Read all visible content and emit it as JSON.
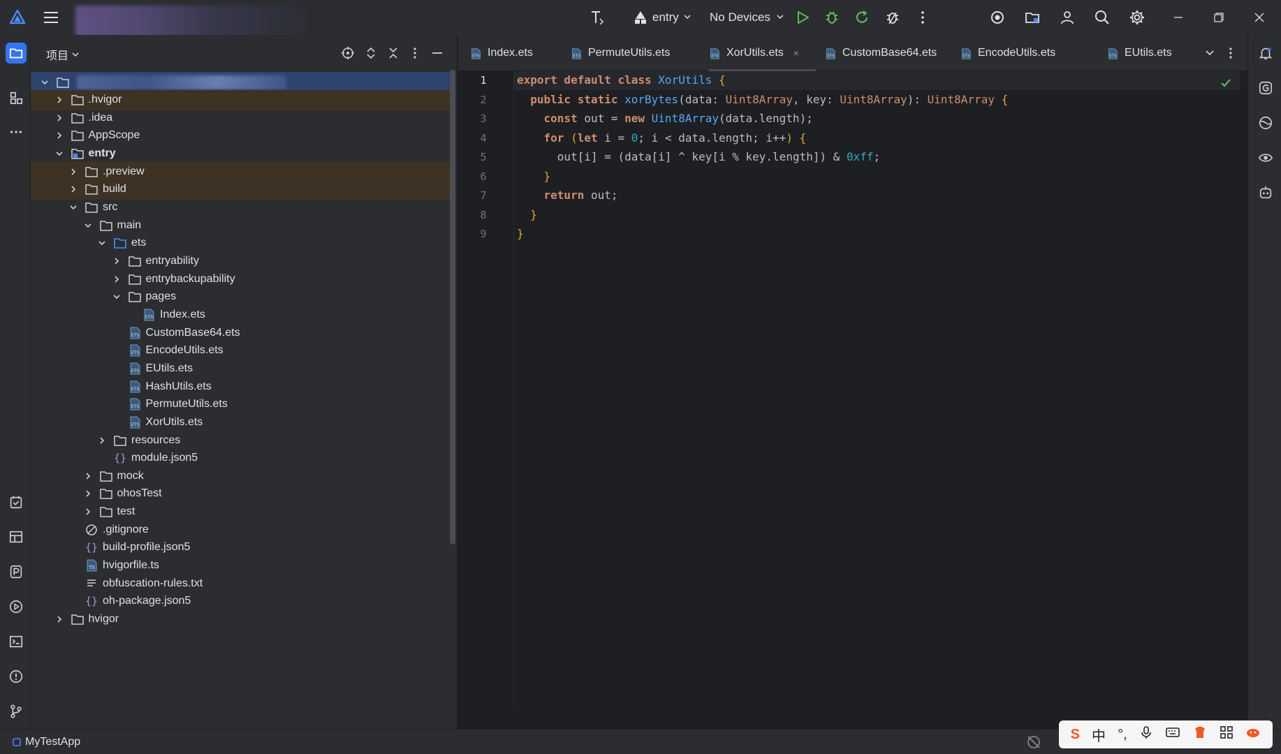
{
  "toolbar": {
    "run_config": "entry",
    "device": "No Devices"
  },
  "project_panel": {
    "title": "项目"
  },
  "tree": [
    {
      "label": "",
      "depth": 0,
      "type": "root",
      "expanded": true,
      "selected": true
    },
    {
      "label": ".hvigor",
      "depth": 1,
      "type": "folder",
      "expanded": false,
      "excluded": true
    },
    {
      "label": ".idea",
      "depth": 1,
      "type": "folder",
      "expanded": false
    },
    {
      "label": "AppScope",
      "depth": 1,
      "type": "folder",
      "expanded": false
    },
    {
      "label": "entry",
      "depth": 1,
      "type": "module",
      "expanded": true,
      "bold": true
    },
    {
      "label": ".preview",
      "depth": 2,
      "type": "folder",
      "expanded": false,
      "excluded": true
    },
    {
      "label": "build",
      "depth": 2,
      "type": "folder",
      "expanded": false,
      "excluded": true
    },
    {
      "label": "src",
      "depth": 2,
      "type": "folder",
      "expanded": true
    },
    {
      "label": "main",
      "depth": 3,
      "type": "folder",
      "expanded": true
    },
    {
      "label": "ets",
      "depth": 4,
      "type": "source-folder",
      "expanded": true
    },
    {
      "label": "entryability",
      "depth": 5,
      "type": "folder",
      "expanded": false
    },
    {
      "label": "entrybackupability",
      "depth": 5,
      "type": "folder",
      "expanded": false
    },
    {
      "label": "pages",
      "depth": 5,
      "type": "folder",
      "expanded": true
    },
    {
      "label": "Index.ets",
      "depth": 6,
      "type": "ets"
    },
    {
      "label": "CustomBase64.ets",
      "depth": 5,
      "type": "ets"
    },
    {
      "label": "EncodeUtils.ets",
      "depth": 5,
      "type": "ets"
    },
    {
      "label": "EUtils.ets",
      "depth": 5,
      "type": "ets"
    },
    {
      "label": "HashUtils.ets",
      "depth": 5,
      "type": "ets"
    },
    {
      "label": "PermuteUtils.ets",
      "depth": 5,
      "type": "ets"
    },
    {
      "label": "XorUtils.ets",
      "depth": 5,
      "type": "ets"
    },
    {
      "label": "resources",
      "depth": 4,
      "type": "folder",
      "expanded": false
    },
    {
      "label": "module.json5",
      "depth": 4,
      "type": "json"
    },
    {
      "label": "mock",
      "depth": 3,
      "type": "folder",
      "expanded": false
    },
    {
      "label": "ohosTest",
      "depth": 3,
      "type": "folder",
      "expanded": false
    },
    {
      "label": "test",
      "depth": 3,
      "type": "folder",
      "expanded": false
    },
    {
      "label": ".gitignore",
      "depth": 2,
      "type": "ignore"
    },
    {
      "label": "build-profile.json5",
      "depth": 2,
      "type": "json"
    },
    {
      "label": "hvigorfile.ts",
      "depth": 2,
      "type": "ts"
    },
    {
      "label": "obfuscation-rules.txt",
      "depth": 2,
      "type": "txt"
    },
    {
      "label": "oh-package.json5",
      "depth": 2,
      "type": "json"
    },
    {
      "label": "hvigor",
      "depth": 1,
      "type": "folder",
      "expanded": false
    }
  ],
  "tabs": [
    {
      "label": "Index.ets",
      "active": false
    },
    {
      "label": "PermuteUtils.ets",
      "active": false
    },
    {
      "label": "XorUtils.ets",
      "active": true
    },
    {
      "label": "CustomBase64.ets",
      "active": false
    },
    {
      "label": "EncodeUtils.ets",
      "active": false
    },
    {
      "label": "EUtils.ets",
      "active": false
    }
  ],
  "tab_close_glyph": "×",
  "editor": {
    "line_numbers": [
      "1",
      "2",
      "3",
      "4",
      "5",
      "6",
      "7",
      "8",
      "9"
    ],
    "lines": [
      [
        [
          "kw",
          "export default class "
        ],
        [
          "cls",
          "XorUtils"
        ],
        [
          "br",
          " {"
        ]
      ],
      [
        [
          "pn",
          "  "
        ],
        [
          "kw",
          "public static "
        ],
        [
          "fn",
          "xorBytes"
        ],
        [
          "pn",
          "(data: "
        ],
        [
          "ty",
          "Uint8Array"
        ],
        [
          "pn",
          ", key: "
        ],
        [
          "ty",
          "Uint8Array"
        ],
        [
          "pn",
          "): "
        ],
        [
          "ty",
          "Uint8Array"
        ],
        [
          "br",
          " {"
        ]
      ],
      [
        [
          "pn",
          "    "
        ],
        [
          "kw",
          "const "
        ],
        [
          "pn",
          "out = "
        ],
        [
          "kw",
          "new "
        ],
        [
          "cls",
          "Uint8Array"
        ],
        [
          "pn",
          "(data.length);"
        ]
      ],
      [
        [
          "pn",
          "    "
        ],
        [
          "kw",
          "for "
        ],
        [
          "br",
          "("
        ],
        [
          "kw",
          "let "
        ],
        [
          "pn",
          "i = "
        ],
        [
          "num",
          "0"
        ],
        [
          "pn",
          "; i < data.length; i++"
        ],
        [
          "br",
          ")"
        ],
        [
          "br",
          " {"
        ]
      ],
      [
        [
          "pn",
          "      out[i] = (data[i] ^ key[i % key.length]) & "
        ],
        [
          "num",
          "0xff"
        ],
        [
          "pn",
          ";"
        ]
      ],
      [
        [
          "br",
          "    }"
        ]
      ],
      [
        [
          "pn",
          "    "
        ],
        [
          "kw",
          "return "
        ],
        [
          "pn",
          "out;"
        ]
      ],
      [
        [
          "br",
          "  }"
        ]
      ],
      [
        [
          "br",
          "}"
        ]
      ]
    ]
  },
  "status": {
    "project_name": "MyTestApp"
  },
  "ime": {
    "chinese_glyph": "中",
    "punct_glyph": "°,"
  },
  "colors": {
    "accent": "#3574f0",
    "run": "#5fb85f",
    "excluded_bg": "#3d3223",
    "selected_bg": "#2e436e"
  }
}
